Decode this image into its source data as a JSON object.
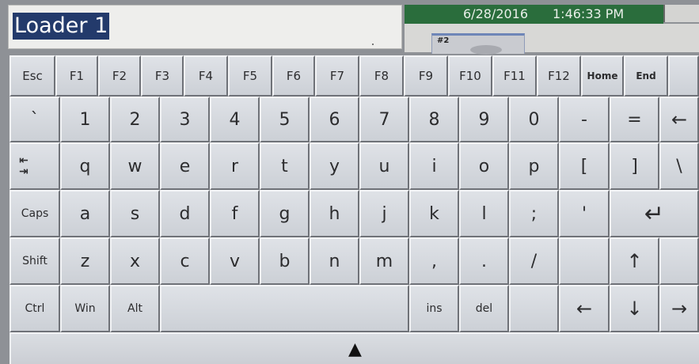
{
  "text_field": {
    "value": "Loader 1"
  },
  "status": {
    "date": "6/28/2016",
    "time": "1:46:33 PM",
    "window_label": "#2"
  },
  "keys": {
    "esc": "Esc",
    "f1": "F1",
    "f2": "F2",
    "f3": "F3",
    "f4": "F4",
    "f5": "F5",
    "f6": "F6",
    "f7": "F7",
    "f8": "F8",
    "f9": "F9",
    "f10": "F10",
    "f11": "F11",
    "f12": "F12",
    "home": "Home",
    "end": "End",
    "grave": "`",
    "n1": "1",
    "n2": "2",
    "n3": "3",
    "n4": "4",
    "n5": "5",
    "n6": "6",
    "n7": "7",
    "n8": "8",
    "n9": "9",
    "n0": "0",
    "minus": "-",
    "equals": "=",
    "backspace": "←",
    "tab_top": "⇤",
    "tab_bottom": "⇥",
    "q": "q",
    "w": "w",
    "e": "e",
    "r": "r",
    "t": "t",
    "y": "y",
    "u": "u",
    "i": "i",
    "o": "o",
    "p": "p",
    "lbracket": "[",
    "rbracket": "]",
    "backslash": "\\",
    "caps": "Caps",
    "a": "a",
    "s": "s",
    "d": "d",
    "f": "f",
    "g": "g",
    "h": "h",
    "j": "j",
    "k": "k",
    "l": "l",
    "semicolon": ";",
    "quote": "'",
    "enter": "↵",
    "shift": "Shift",
    "z": "z",
    "x": "x",
    "c": "c",
    "v": "v",
    "b": "b",
    "n": "n",
    "m": "m",
    "comma": ",",
    "period": ".",
    "slash": "/",
    "up": "↑",
    "ctrl": "Ctrl",
    "win": "Win",
    "alt": "Alt",
    "ins": "ins",
    "del": "del",
    "left": "←",
    "down": "↓",
    "right": "→",
    "hide": "▲"
  }
}
